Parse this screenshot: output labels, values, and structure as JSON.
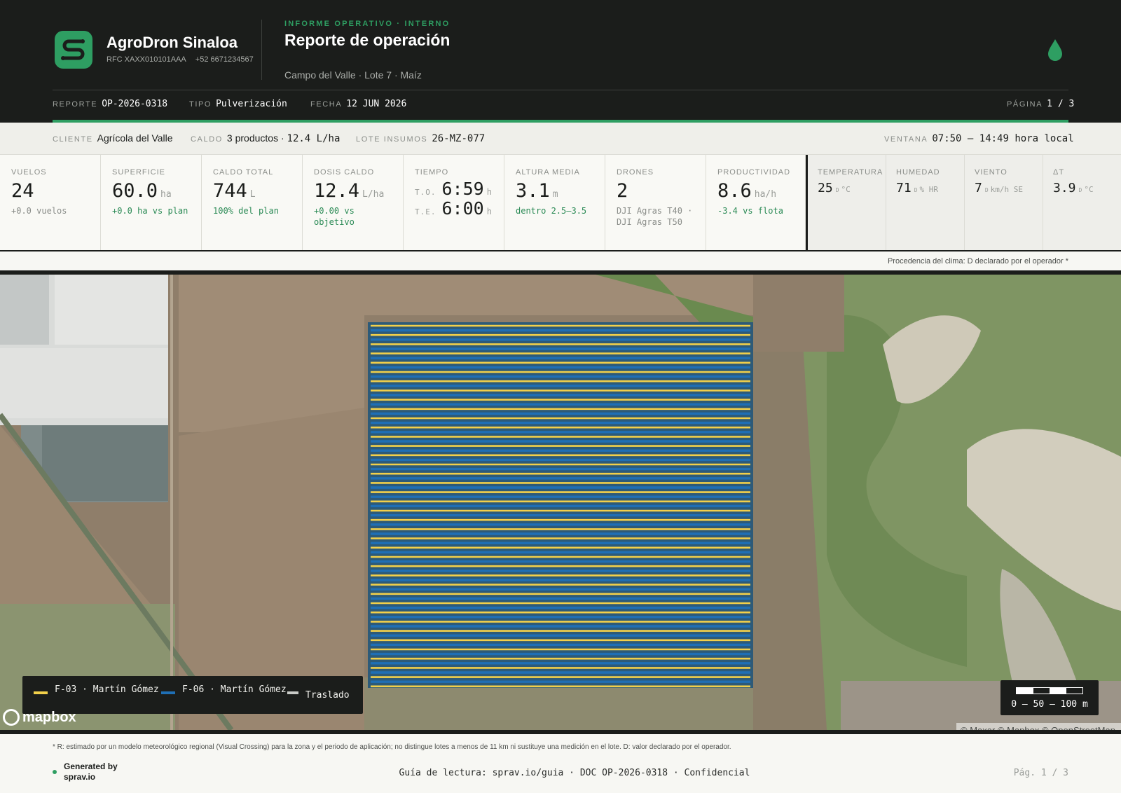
{
  "brand": {
    "name": "AgroDron Sinaloa",
    "rfc": "RFC XAXX010101AAA",
    "phone": "+52 6671234567",
    "accent": "#2e9e62"
  },
  "doc": {
    "kicker": "INFORME OPERATIVO · INTERNO",
    "title": "Reporte de operación",
    "subtitle": "Campo del Valle · Lote 7 · Maíz"
  },
  "meta": {
    "report_label": "REPORTE",
    "report_value": "OP-2026-0318",
    "type_label": "TIPO",
    "type_value": "Pulverización",
    "date_label": "FECHA",
    "date_value": "12 JUN 2026",
    "page_label": "PÁGINA",
    "page_value": "1 / 3"
  },
  "client": {
    "client_label": "CLIENTE",
    "client_value": "Agrícola del Valle",
    "caldo_label": "CALDO",
    "caldo_products": "3 productos · ",
    "caldo_rate": "12.4 L/ha",
    "lote_label": "LOTE INSUMOS",
    "lote_value": "26-MZ-077",
    "window_label": "VENTANA",
    "window_value": "07:50 – 14:49 hora local"
  },
  "kpis": {
    "vuelos": {
      "label": "VUELOS",
      "value": "24",
      "sub": "+0.0 vuelos"
    },
    "superficie": {
      "label": "SUPERFICIE",
      "value": "60.0",
      "unit": "ha",
      "sub": "+0.0 ha vs plan"
    },
    "caldo_total": {
      "label": "CALDO TOTAL",
      "value": "744",
      "unit": "L",
      "sub": "100% del plan"
    },
    "dosis": {
      "label": "DOSIS CALDO",
      "value": "12.4",
      "unit": "L/ha",
      "sub": "+0.00 vs objetivo"
    },
    "tiempo": {
      "label": "TIEMPO",
      "to_label": "T.O.",
      "to_value": "6:59",
      "te_label": "T.E.",
      "te_value": "6:00",
      "unit": "h"
    },
    "altura": {
      "label": "ALTURA MEDIA",
      "value": "3.1",
      "unit": "m",
      "sub": "dentro 2.5–3.5"
    },
    "drones": {
      "label": "DRONES",
      "value": "2",
      "sub": "DJI Agras T40 · DJI Agras T50"
    },
    "productividad": {
      "label": "PRODUCTIVIDAD",
      "value": "8.6",
      "unit": "ha/h",
      "sub": "-3.4 vs flota"
    }
  },
  "weather": {
    "temp": {
      "label": "TEMPERATURA",
      "value": "25",
      "src": "D",
      "unit": "°C"
    },
    "humedad": {
      "label": "HUMEDAD",
      "value": "71",
      "src": "D",
      "unit": "% HR"
    },
    "viento": {
      "label": "VIENTO",
      "value": "7",
      "src": "D",
      "unit": "km/h SE"
    },
    "delta_t": {
      "label": "ΔT",
      "value": "3.9",
      "src": "D",
      "unit": "°C"
    },
    "source_note": "Procedencia del clima: D declarado por el operador *"
  },
  "map": {
    "legend": [
      {
        "label": "F-03 · Martín Gómez",
        "color": "#f2d04a"
      },
      {
        "label": "F-06 · Martín Gómez",
        "color": "#1f6fb5"
      },
      {
        "label": "Traslado",
        "color": "#c9cbc7"
      }
    ],
    "scale_label": "0 – 50 – 100 m",
    "mapbox_label": "mapbox",
    "credits": "© Maxar © Mapbox © OpenStreetMap"
  },
  "footer": {
    "footnote": "* R: estimado por un modelo meteorológico regional (Visual Crossing) para la zona y el periodo de aplicación; no distingue lotes a menos de 11 km ni sustituye una medición en el lote. D: valor declarado por el operador.",
    "generated": "Generated by sprav.io",
    "center": "Guía de lectura: sprav.io/guia · DOC OP-2026-0318 · Confidencial",
    "page": "Pág. 1 / 3"
  }
}
